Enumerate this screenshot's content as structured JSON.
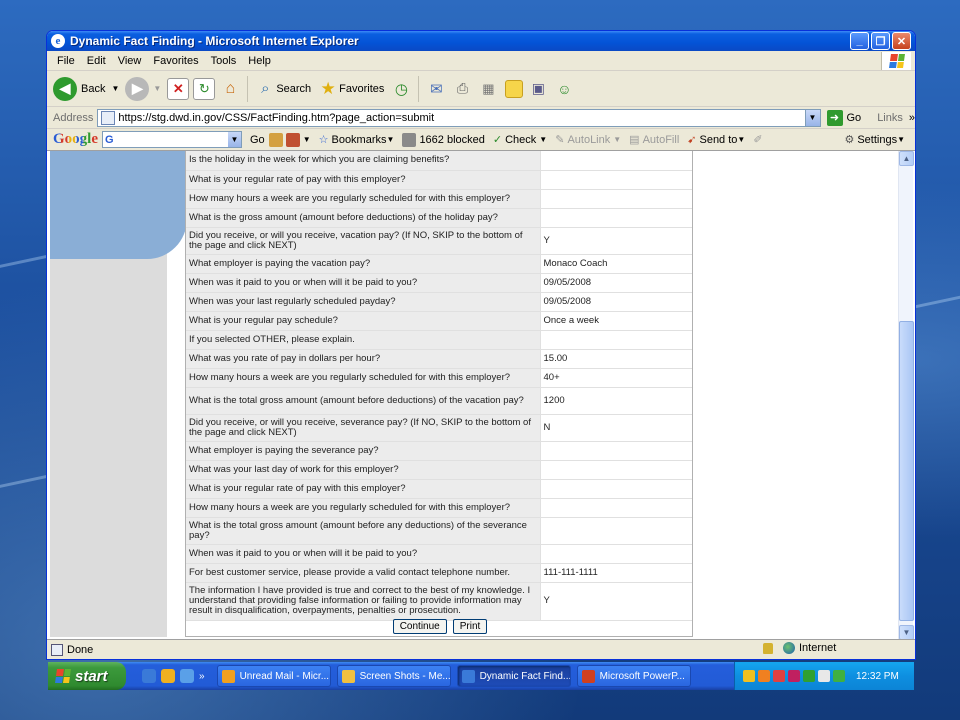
{
  "window": {
    "title": "Dynamic Fact Finding - Microsoft Internet Explorer",
    "min_label": "_",
    "max_label": "❐",
    "close_label": "✕"
  },
  "menu": [
    "File",
    "Edit",
    "View",
    "Favorites",
    "Tools",
    "Help"
  ],
  "toolbar": {
    "back": "Back",
    "search": "Search",
    "favorites": "Favorites"
  },
  "address": {
    "label": "Address",
    "url": "https://stg.dwd.in.gov/CSS/FactFinding.htm?page_action=submit",
    "go": "Go",
    "links": "Links"
  },
  "google": {
    "logo": "Google",
    "go": "Go",
    "bookmarks": "Bookmarks",
    "blocked": "1662 blocked",
    "check": "Check",
    "autolink": "AutoLink",
    "autofill": "AutoFill",
    "sendto": "Send to",
    "settings": "Settings"
  },
  "form": {
    "rows": [
      {
        "q": "Is the holiday in the week for which you are claiming benefits?",
        "a": ""
      },
      {
        "q": "What is your regular rate of pay with this employer?",
        "a": ""
      },
      {
        "q": "How many hours a week are you regularly scheduled for with this employer?",
        "a": ""
      },
      {
        "q": "What is the gross amount (amount before deductions) of the holiday pay?",
        "a": ""
      },
      {
        "q": "Did you receive, or will you receive, vacation pay? (If NO, SKIP to the bottom of the page and click NEXT)",
        "a": "Y"
      },
      {
        "q": "What employer is paying the vacation pay?",
        "a": "Monaco Coach"
      },
      {
        "q": "When was it paid to you or when will it be paid to you?",
        "a": "09/05/2008"
      },
      {
        "q": "When was your last regularly scheduled payday?",
        "a": "09/05/2008"
      },
      {
        "q": "What is your regular pay schedule?",
        "a": "Once a week"
      },
      {
        "q": "If you selected OTHER, please explain.",
        "a": ""
      },
      {
        "q": "What was you rate of pay in dollars per hour?",
        "a": "15.00"
      },
      {
        "q": "How many hours a week are you regularly scheduled for with this employer?",
        "a": "40+"
      },
      {
        "q": "What is the total gross amount (amount before deductions) of the vacation pay?",
        "a": "1200"
      },
      {
        "q": "Did you receive, or will you receive, severance pay? (If NO, SKIP to the bottom of the page and click NEXT)",
        "a": "N"
      },
      {
        "q": "What employer is paying the severance pay?",
        "a": ""
      },
      {
        "q": "What was your last day of work for this employer?",
        "a": ""
      },
      {
        "q": "What is your regular rate of pay with this employer?",
        "a": ""
      },
      {
        "q": "How many hours a week are you regularly scheduled for with this employer?",
        "a": ""
      },
      {
        "q": "What is the total gross amount (amount before any deductions) of the severance pay?",
        "a": ""
      },
      {
        "q": "When was it paid to you or when will it be paid to you?",
        "a": ""
      },
      {
        "q": "For best customer service, please provide a valid contact telephone number.",
        "a": "111-111-1111"
      },
      {
        "q": "The information I have provided is true and correct to the best of my knowledge. I understand that providing false information or failing to provide information may result in disqualification, overpayments, penalties or prosecution.",
        "a": "Y"
      }
    ],
    "continue": "Continue",
    "print": "Print"
  },
  "status": {
    "text": "Done",
    "zone": "Internet"
  },
  "taskbar": {
    "start": "start",
    "more": "»",
    "tasks": [
      {
        "label": "Unread Mail - Micr...",
        "active": false
      },
      {
        "label": "Screen Shots - Me...",
        "active": false
      },
      {
        "label": "Dynamic Fact Find...",
        "active": true
      },
      {
        "label": "Microsoft PowerP...",
        "active": false
      }
    ],
    "clock": "12:32 PM"
  },
  "colors": {
    "titlebar": "#0453d6",
    "left_panel": "#dcdcdc",
    "blue_shape": "#8aaed6",
    "start_green": "#3c9a3c"
  }
}
